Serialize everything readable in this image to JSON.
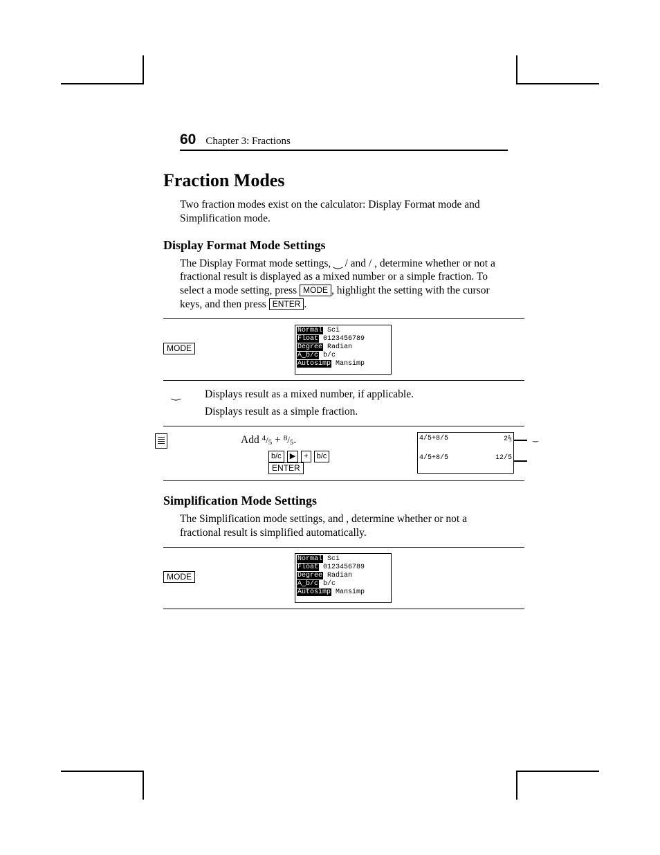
{
  "page_number": "60",
  "running_head": "Chapter 3: Fractions",
  "title": "Fraction Modes",
  "intro": "Two fraction modes exist on the calculator: Display Format mode and Simplification mode.",
  "dfm": {
    "heading": "Display Format Mode Settings",
    "para_a": "The Display Format mode settings, ",
    "sym1": "‿  /",
    "para_b": "  and  ",
    "sym2": "/",
    "para_c": " , determine whether or not a fractional result is displayed as a mixed number or a simple fraction. To select a mode setting, press ",
    "key_mode": "MODE",
    "para_d": ", highlight the setting with the cursor keys, and then press ",
    "key_enter": "ENTER",
    "para_e": "."
  },
  "screen1": {
    "l1a": "Normal",
    "l1b": " Sci",
    "l2a": "Float",
    "l2b": " 0123456789",
    "l3a": "Degree",
    "l3b": " Radian",
    "l4a": "A‿b/c",
    "l4b": " b/c",
    "l5a": "Autosimp",
    "l5b": " Mansimp"
  },
  "defs": {
    "r1_sym": "‿",
    "r1_text": "Displays result as a mixed number, if applicable.",
    "r2_sym": "",
    "r2_text": "Displays result as a simple fraction."
  },
  "example": {
    "text_a": "Add ",
    "f1n": "4",
    "f1d": "5",
    "text_b": " + ",
    "f2n": "8",
    "f2d": "5",
    "text_c": ".",
    "keys": [
      "b/c",
      "▶",
      "+",
      "b/c"
    ],
    "key_enter": "ENTER",
    "screen_l1_left": "4/5+8/5",
    "screen_l1_right": "2⅖",
    "screen_l2_left": "4/5+8/5",
    "screen_l2_right": "12/5",
    "tag": "‿"
  },
  "simp": {
    "heading": "Simplification Mode Settings",
    "para_a": "The Simplification mode settings,                    and                , determine whether or not a fractional result is simplified automatically."
  },
  "screen2": {
    "l1a": "Normal",
    "l1b": " Sci",
    "l2a": "Float",
    "l2b": " 0123456789",
    "l3a": "Degree",
    "l3b": " Radian",
    "l4a": "A‿b/c",
    "l4b": " b/c",
    "l5a": "Autosimp",
    "l5b": " Mansimp"
  },
  "key_mode": "MODE"
}
